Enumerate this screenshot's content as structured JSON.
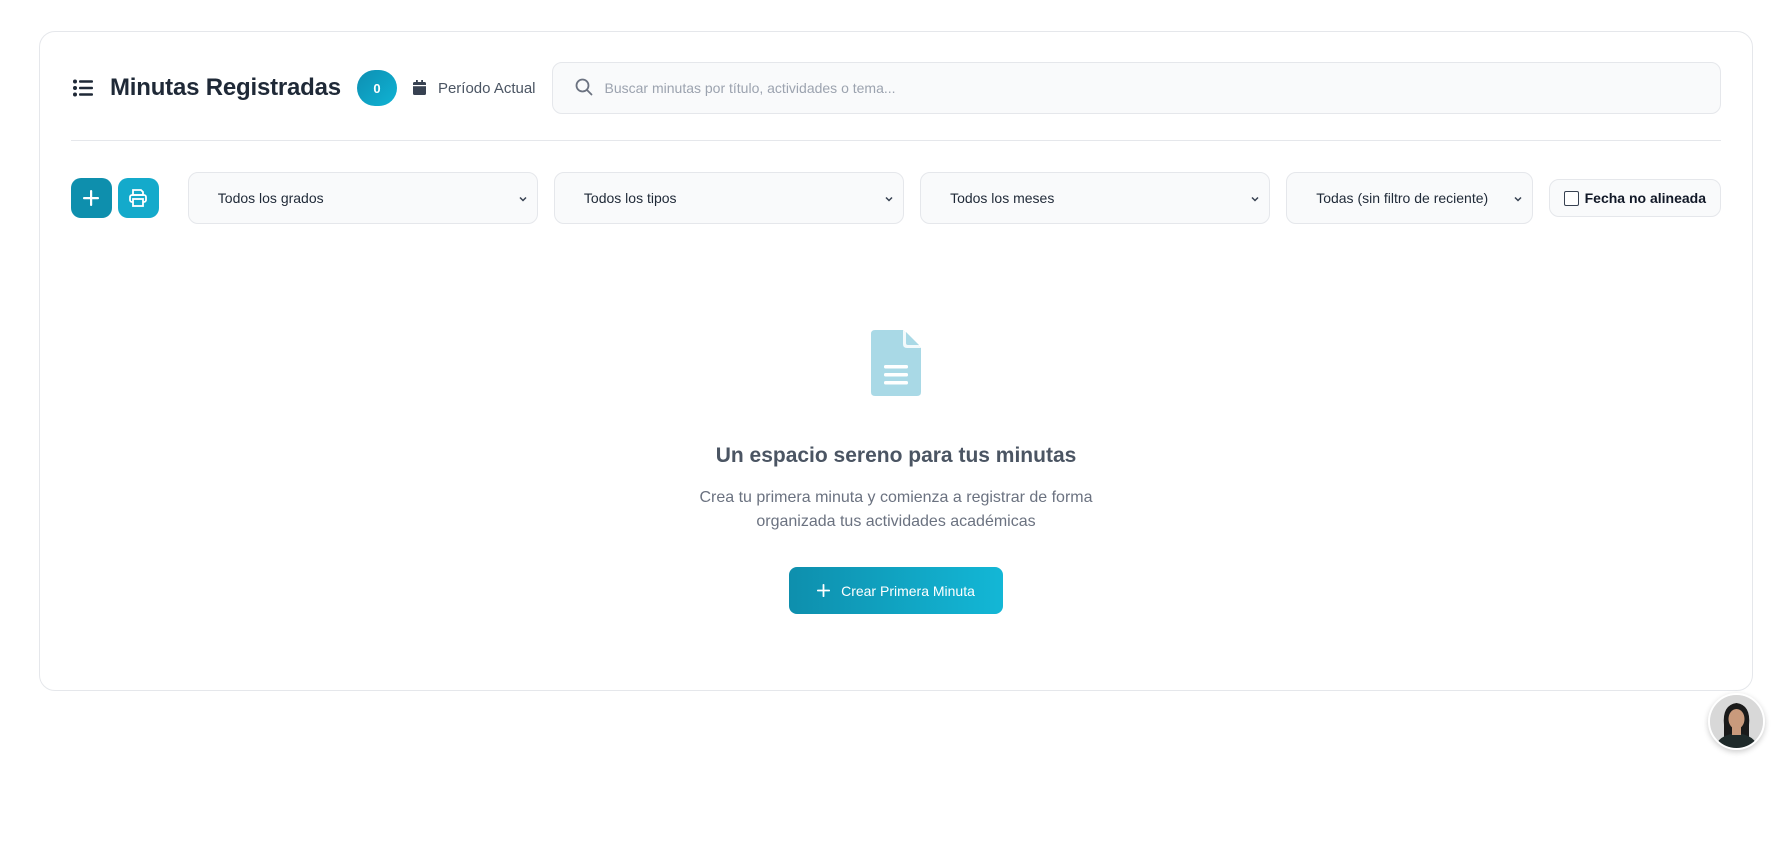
{
  "header": {
    "title": "Minutas Registradas",
    "count": "0",
    "period_label": "Período Actual",
    "search_placeholder": "Buscar minutas por título, actividades o tema..."
  },
  "filters": {
    "grade": {
      "selected": "Todos los grados"
    },
    "type": {
      "selected": "Todos los tipos"
    },
    "month": {
      "selected": "Todos los meses"
    },
    "recent": {
      "selected": "Todas (sin filtro de reciente)"
    },
    "unaligned_date": {
      "label": "Fecha no alineada",
      "checked": false
    }
  },
  "empty_state": {
    "title": "Un espacio sereno para tus minutas",
    "line1": "Crea tu primera minuta y comienza a registrar de forma",
    "line2": "organizada tus actividades académicas",
    "button_label": "Crear Primera Minuta"
  },
  "icons": {
    "list": "list-icon",
    "calendar": "calendar-icon",
    "search": "search-icon",
    "add": "plus-icon",
    "print": "printer-icon",
    "document": "document-icon",
    "chevron": "chevron-down-icon"
  },
  "colors": {
    "accent": "#0e8fad",
    "accent_light": "#14aacb",
    "doc_icon": "#a9d9e6"
  }
}
